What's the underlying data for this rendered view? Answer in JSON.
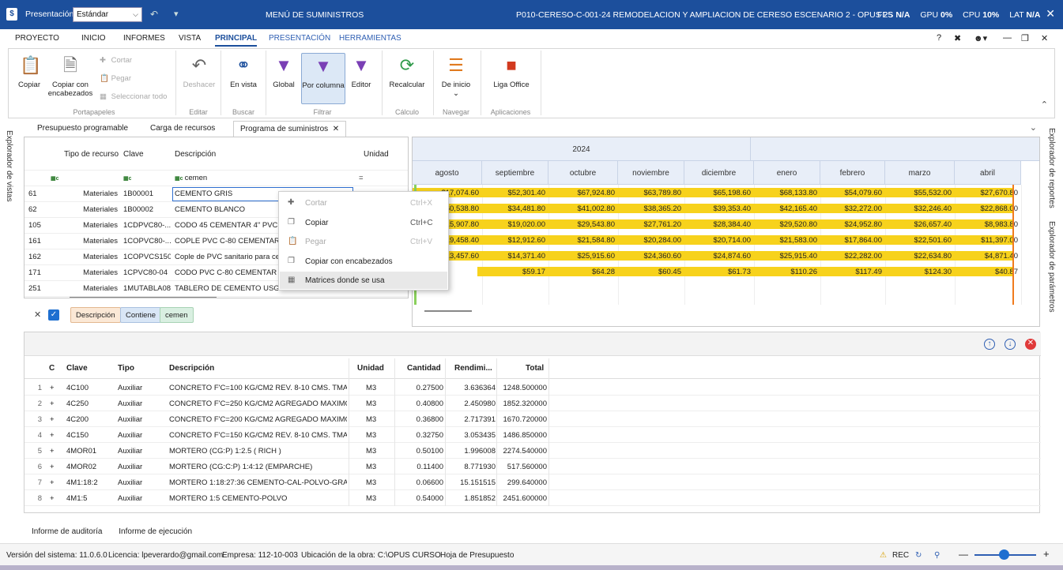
{
  "titlebar": {
    "logo": "$",
    "presentation_label": "Presentación:",
    "presentation_value": "Estándar",
    "center_title": "MENÚ DE SUMINISTROS",
    "project_title": "P010-CERESO-C-001-24 REMODELACION Y AMPLIACION DE CERESO ESCENARIO 2 - OPUS 25",
    "fps_label": "FPS",
    "fps_value": "N/A",
    "gpu_label": "GPU",
    "gpu_value": "0%",
    "cpu_label": "CPU",
    "cpu_value": "10%",
    "lat_label": "LAT",
    "lat_value": "N/A"
  },
  "menu": {
    "items": [
      "PROYECTO",
      "INICIO",
      "INFORMES",
      "VISTA",
      "PRINCIPAL",
      "PRESENTACIÓN",
      "HERRAMIENTAS"
    ],
    "active": "PRINCIPAL",
    "help": "?"
  },
  "ribbon": {
    "copy": "Copiar",
    "copy_headers": "Copiar con encabezados",
    "cut": "Cortar",
    "paste": "Pegar",
    "select_all": "Seleccionar todo",
    "group_clipboard": "Portapapeles",
    "undo": "Deshacer",
    "group_edit": "Editar",
    "in_view": "En vista",
    "group_search": "Buscar",
    "global": "Global",
    "by_column": "Por columna",
    "editor": "Editor",
    "group_filter": "Filtrar",
    "recalc": "Recalcular",
    "group_calc": "Cálculo",
    "from_start": "De inicio",
    "group_nav": "Navegar",
    "office": "Liga Office",
    "group_apps": "Aplicaciones"
  },
  "side": {
    "left": "Explorador de vistas",
    "right1": "Explorador de reportes",
    "right2": "Explorador de parámetros"
  },
  "tabs": [
    "Presupuesto programable",
    "Carga de recursos",
    "Programa de suministros"
  ],
  "grid": {
    "headers": {
      "tipo": "Tipo de recurso",
      "clave": "Clave",
      "desc": "Descripción",
      "unidad": "Unidad"
    },
    "filter": {
      "desc": "cemen",
      "unidad": "="
    },
    "rows": [
      {
        "n": "61",
        "tipo": "Materiales",
        "clave": "1B00001",
        "desc": "CEMENTO GRIS"
      },
      {
        "n": "62",
        "tipo": "Materiales",
        "clave": "1B00002",
        "desc": "CEMENTO BLANCO"
      },
      {
        "n": "105",
        "tipo": "Materiales",
        "clave": "1CDPVC80-...",
        "desc": "CODO 45 CEMENTAR 4\" PVC C"
      },
      {
        "n": "161",
        "tipo": "Materiales",
        "clave": "1COPVC80-...",
        "desc": "COPLE PVC C-80 CEMENTAR 4\""
      },
      {
        "n": "162",
        "tipo": "Materiales",
        "clave": "1COPVCS150",
        "desc": "Cople de PVC sanitario para cer"
      },
      {
        "n": "171",
        "tipo": "Materiales",
        "clave": "1CPVC80-04",
        "desc": "CODO PVC C-80 CEMENTAR 90"
      },
      {
        "n": "251",
        "tipo": "Materiales",
        "clave": "1MUTABLA08",
        "desc": "TABLERO DE CEMENTO USG DU"
      }
    ],
    "chips": [
      "Descripción",
      "Contiene",
      "cemen"
    ]
  },
  "timeline": {
    "year": "2024",
    "months": [
      "agosto",
      "septiembre",
      "octubre",
      "noviembre",
      "diciembre",
      "enero",
      "febrero",
      "marzo",
      "abril"
    ],
    "rows": [
      [
        "$17,074.60",
        "$52,301.40",
        "$67,924.80",
        "$63,789.80",
        "$65,198.60",
        "$68,133.80",
        "$54,079.60",
        "$55,532.00",
        "$27,670.80"
      ],
      [
        "$60,538.80",
        "$34,481.80",
        "$41,002.80",
        "$38,365.20",
        "$39,353.40",
        "$42,165.40",
        "$32,272.00",
        "$32,246.40",
        "$22,868.00"
      ],
      [
        "$15,907.80",
        "$19,020.00",
        "$29,543.80",
        "$27,761.20",
        "$28,384.40",
        "$29,520.80",
        "$24,952.80",
        "$26,657.40",
        "$8,983.80"
      ],
      [
        "$19,458.40",
        "$12,912.60",
        "$21,584.80",
        "$20,284.00",
        "$20,714.00",
        "$21,583.00",
        "$17,864.00",
        "$22,501.60",
        "$11,397.00"
      ],
      [
        "$13,457.60",
        "$14,371.40",
        "$25,915.60",
        "$24,360.60",
        "$24,874.60",
        "$25,915.40",
        "$22,282.00",
        "$22,634.80",
        "$4,871.40"
      ],
      [
        "",
        "$59.17",
        "$64.28",
        "$60.45",
        "$61.73",
        "$110.26",
        "$117.49",
        "$124.30",
        "$40.87"
      ]
    ]
  },
  "context_menu": [
    {
      "label": "Cortar",
      "key": "Ctrl+X",
      "disabled": true
    },
    {
      "label": "Copiar",
      "key": "Ctrl+C",
      "disabled": false
    },
    {
      "label": "Pegar",
      "key": "Ctrl+V",
      "disabled": true
    },
    {
      "label": "Copiar con encabezados",
      "key": "",
      "disabled": false
    },
    {
      "label": "Matrices donde se usa",
      "key": "",
      "disabled": false
    }
  ],
  "matrix": {
    "headers": {
      "c": "C",
      "clave": "Clave",
      "tipo": "Tipo",
      "desc": "Descripción",
      "unidad": "Unidad",
      "cantidad": "Cantidad",
      "rend": "Rendimi...",
      "total": "Total"
    },
    "rows": [
      {
        "n": "1",
        "clave": "4C100",
        "tipo": "Auxiliar",
        "desc": "CONCRETO F'C=100 KG/CM2 REV. 8-10 CMS. TMA...",
        "unidad": "M3",
        "cantidad": "0.27500",
        "rend": "3.636364",
        "total": "1248.500000"
      },
      {
        "n": "2",
        "clave": "4C250",
        "tipo": "Auxiliar",
        "desc": "CONCRETO F'C=250 KG/CM2 AGREGADO MAXIMO...",
        "unidad": "M3",
        "cantidad": "0.40800",
        "rend": "2.450980",
        "total": "1852.320000"
      },
      {
        "n": "3",
        "clave": "4C200",
        "tipo": "Auxiliar",
        "desc": "CONCRETO F'C=200 KG/CM2 AGREGADO MAXIMO...",
        "unidad": "M3",
        "cantidad": "0.36800",
        "rend": "2.717391",
        "total": "1670.720000"
      },
      {
        "n": "4",
        "clave": "4C150",
        "tipo": "Auxiliar",
        "desc": "CONCRETO F'C=150 KG/CM2 REV. 8-10 CMS. TMA...",
        "unidad": "M3",
        "cantidad": "0.32750",
        "rend": "3.053435",
        "total": "1486.850000"
      },
      {
        "n": "5",
        "clave": "4MOR01",
        "tipo": "Auxiliar",
        "desc": "MORTERO (CG:P) 1:2.5 ( RICH )",
        "unidad": "M3",
        "cantidad": "0.50100",
        "rend": "1.996008",
        "total": "2274.540000"
      },
      {
        "n": "6",
        "clave": "4MOR02",
        "tipo": "Auxiliar",
        "desc": "MORTERO (CG:C:P) 1:4:12 (EMPARCHE)",
        "unidad": "M3",
        "cantidad": "0.11400",
        "rend": "8.771930",
        "total": "517.560000"
      },
      {
        "n": "7",
        "clave": "4M1:18:2",
        "tipo": "Auxiliar",
        "desc": "MORTERO 1:18:27:36 CEMENTO-CAL-POLVO-GRA...",
        "unidad": "M3",
        "cantidad": "0.06600",
        "rend": "15.151515",
        "total": "299.640000"
      },
      {
        "n": "8",
        "clave": "4M1:5",
        "tipo": "Auxiliar",
        "desc": "MORTERO 1:5 CEMENTO-POLVO",
        "unidad": "M3",
        "cantidad": "0.54000",
        "rend": "1.851852",
        "total": "2451.600000"
      }
    ]
  },
  "bottom_tabs": [
    "Informe de auditoría",
    "Informe de ejecución"
  ],
  "status": {
    "version": "Versión del sistema: 11.0.6.0",
    "license": "Licencia: lpeverardo@gmail.com",
    "company": "Empresa: 112-10-003",
    "location": "Ubicación de la obra: C:\\OPUS CURSO",
    "sheet": "Hoja de Presupuesto",
    "rec": "REC"
  },
  "colors": {
    "accent": "#1c4f9c",
    "highlight": "#f7d21c"
  }
}
